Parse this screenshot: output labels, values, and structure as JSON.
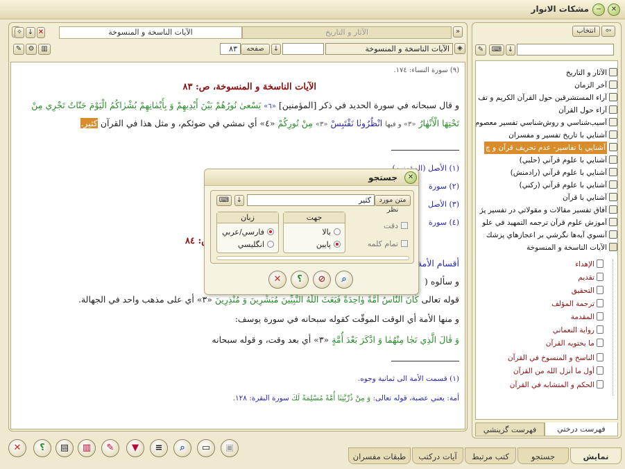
{
  "window": {
    "title": "مشكات الانوار",
    "close_icon": "close-icon",
    "minimize_icon": "minimize-icon"
  },
  "right_panel": {
    "select_button": "انتخاب",
    "search_value": "",
    "items": [
      {
        "label": "الآثار و التاريخ"
      },
      {
        "label": "آخر الزمان"
      },
      {
        "label": "آراء المستشرقين حول القرآن الكريم و تف"
      },
      {
        "label": "آراء حول القرآن"
      },
      {
        "label": "آسيب‌شناسي و روش‌شناسي تفسير معصوم"
      },
      {
        "label": "آشنايي با تاريخ تفسير و مفسران"
      },
      {
        "label": "آشنايي با تفاسير- عدم تحريف قرآن و چ"
      },
      {
        "label": "آشنايي با علوم قرآني (حلبي)"
      },
      {
        "label": "آشنايي با علوم قرآني (رادمنش)"
      },
      {
        "label": "آشنايي با علوم قرآني (ركني)"
      },
      {
        "label": "آشنايي با قرآن"
      },
      {
        "label": "آفاق تفسير مقالات و مقولاتي در تفسير پژ"
      },
      {
        "label": "آموزش علوم قرآن ترجمه التمهيد في علو"
      },
      {
        "label": "آنسوي آيه‌ها نگرشي بر اعجازهاي پزشك"
      },
      {
        "label": "الآيات الناسخة و المنسوخة"
      }
    ],
    "children": [
      {
        "label": "الإهداء"
      },
      {
        "label": "تقديم"
      },
      {
        "label": "التحقيق"
      },
      {
        "label": "ترجمة المؤلف"
      },
      {
        "label": "المقدمة"
      },
      {
        "label": "رواية النعماني"
      },
      {
        "label": "ما يحتويه القرآن"
      },
      {
        "label": "الناسخ و المنسوخ في القرآن"
      },
      {
        "label": "أول ما أنزل الله من القرآن"
      },
      {
        "label": "الحكم و المتشابه في القرآن"
      }
    ],
    "tab_tree": "فهرست درختي",
    "tab_index": "فهرست گزينشي"
  },
  "main": {
    "tab_inactive": "الآثار و التاريخ",
    "tab_active": "الآيات الناسخة و المنسوخة",
    "book_select": "الآيات الناسخة و المنسوخة",
    "page_label": "صفحه",
    "page_value": "٨٣",
    "content": {
      "ref1": "(٩) سورة النساء: ١٧٤.",
      "heading": "الآيات الناسخة و المنسوخة، ص: ٨٣",
      "l1_a": "و قال سبحانه في سورة الحديد في ذكر [المؤمنين]",
      "l1_b": "«٦»",
      "l1_c": "يَسْعىٰ نُورُهُمْ بَيْنَ أَيْدِيهِمْ وَ بِأَيْمٰانِهِمْ بُشْرٰاكُمُ الْيَوْمَ جَنّٰاتٌ تَجْرِي مِنْ",
      "l2_a": "تَحْتِهَا الْأَنْهٰارُ",
      "l2_b": "«٣» و فيها",
      "l2_c": "انْظُرُونٰا نَقْتَبِسْ",
      "l2_d": "«٣»",
      "l2_e": "مِنْ نُورِكُمْ",
      "l2_f": "«٤» أي نمشي في ضوئكم، و مثل هذا في القرآن",
      "l2_hl": "كثير.",
      "fn1": "(١) الأصل (المؤمنين).",
      "fn2": "(٢) سورة",
      "fn3": "(٣) الأصل",
      "fn4": "(٤) سورة",
      "heading2": "ص: ٨٤",
      "section": "أقسام الأمة",
      "l5": "و سألوه (",
      "l6_a": "قوله تعالى",
      "l6_b": "كٰانَ النّٰاسُ أُمَّةً وٰاحِدَةً فَبَعَثَ اللّٰهُ النَّبِيِّينَ مُبَشِّرِينَ وَ مُنْذِرِينَ",
      "l6_c": "«٣» أي على مذهب واحد في الجهالة.",
      "l7": "و منها الأمة أي الوقت الموقّت كقوله سبحانه في سورة يوسف:",
      "l8_a": "وَ قٰالَ الَّذِي نَجٰا مِنْهُمٰا وَ ادَّكَرَ بَعْدَ أُمَّةٍ",
      "l8_b": "«٣» أي بعد وقت، و قوله سبحانه",
      "fn5": "(١) قسمت الأمة الى ثمانية وجوه.",
      "fn6_a": "أمة: يعني عصبة، قوله تعالى:",
      "fn6_b": "وَ مِنْ ذُرِّيَّتِنٰا أُمَّةً مُسْلِمَةً لَكَ",
      "fn6_c": "سورة البقرة: ١٢٨."
    }
  },
  "dialog": {
    "title": "جستجو",
    "search_label": "متن مورد نظر",
    "search_value": "كثير",
    "lang_group": "زبان",
    "lang_opt1": "فارسي/عربي",
    "lang_opt2": "انگليسي",
    "dir_group": "جهت",
    "dir_opt1": "بالا",
    "dir_opt2": "پايين",
    "check_exact": "دقت",
    "check_whole": "تمام كلمه"
  },
  "bottom_tabs": [
    {
      "label": "نمايش"
    },
    {
      "label": "جستجو"
    },
    {
      "label": "كتب مرتبط"
    },
    {
      "label": "آيات دركتب"
    },
    {
      "label": "طبقات مفسران"
    }
  ]
}
